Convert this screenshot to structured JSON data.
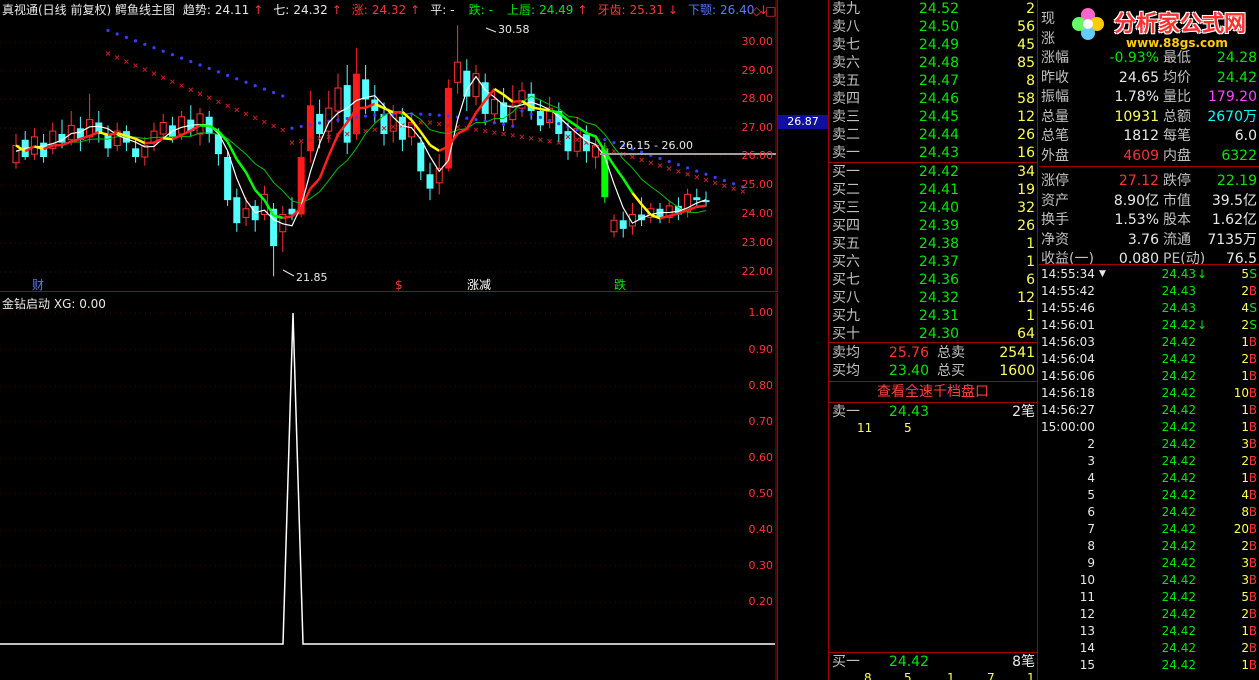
{
  "main_chart": {
    "title": "真视通(日线 前复权) 鳄鱼线主图",
    "indicators": [
      {
        "label": "趋势:",
        "value": "24.11",
        "arrow": "↑",
        "color": "#e8e8e8"
      },
      {
        "label": "七:",
        "value": "24.32",
        "arrow": "↑",
        "color": "#e8e8e8"
      },
      {
        "label": "涨:",
        "value": "24.32",
        "arrow": "↑",
        "color": "#ff3232"
      },
      {
        "label": "平:",
        "value": "-",
        "arrow": "",
        "color": "#e8e8e8"
      },
      {
        "label": "跌:",
        "value": "-",
        "arrow": "",
        "color": "#00e600"
      },
      {
        "label": "上唇:",
        "value": "24.49",
        "arrow": "↑",
        "color": "#00e600"
      },
      {
        "label": "牙齿:",
        "value": "25.31",
        "arrow": "↓",
        "color": "#ff3232"
      },
      {
        "label": "下颚:",
        "value": "26.40",
        "arrow": "↓",
        "color": "#5a78ff"
      }
    ],
    "y_axis": [
      "30.00",
      "29.00",
      "28.00",
      "27.00",
      "26.00",
      "25.00",
      "24.00",
      "23.00",
      "22.00"
    ],
    "current_price_tag": "26.87",
    "high_label": "30.58",
    "low_label": "21.85",
    "range_label": "26.15 - 26.00",
    "signals": [
      {
        "text": "财",
        "color": "#5a78ff"
      },
      {
        "text": "$",
        "color": "#ff3232"
      },
      {
        "text": "涨减",
        "color": "#ffffff"
      },
      {
        "text": "跌",
        "color": "#00e600"
      }
    ]
  },
  "sub_chart": {
    "title": "金钻启动",
    "value_label": "XG: 0.00",
    "y_axis": [
      "1.00",
      "0.90",
      "0.80",
      "0.70",
      "0.60",
      "0.50",
      "0.40",
      "0.30",
      "0.20"
    ]
  },
  "quote": {
    "asks": [
      {
        "label": "卖九",
        "price": "24.52",
        "vol": "2"
      },
      {
        "label": "卖八",
        "price": "24.50",
        "vol": "56"
      },
      {
        "label": "卖七",
        "price": "24.49",
        "vol": "45"
      },
      {
        "label": "卖六",
        "price": "24.48",
        "vol": "85"
      },
      {
        "label": "卖五",
        "price": "24.47",
        "vol": "8"
      },
      {
        "label": "卖四",
        "price": "24.46",
        "vol": "58"
      },
      {
        "label": "卖三",
        "price": "24.45",
        "vol": "12"
      },
      {
        "label": "卖二",
        "price": "24.44",
        "vol": "26"
      },
      {
        "label": "卖一",
        "price": "24.43",
        "vol": "16"
      }
    ],
    "bids": [
      {
        "label": "买一",
        "price": "24.42",
        "vol": "34"
      },
      {
        "label": "买二",
        "price": "24.41",
        "vol": "19"
      },
      {
        "label": "买三",
        "price": "24.40",
        "vol": "32"
      },
      {
        "label": "买四",
        "price": "24.39",
        "vol": "26"
      },
      {
        "label": "买五",
        "price": "24.38",
        "vol": "1"
      },
      {
        "label": "买六",
        "price": "24.37",
        "vol": "1"
      },
      {
        "label": "买七",
        "price": "24.36",
        "vol": "6"
      },
      {
        "label": "买八",
        "price": "24.32",
        "vol": "12"
      },
      {
        "label": "买九",
        "price": "24.31",
        "vol": "1"
      },
      {
        "label": "买十",
        "price": "24.30",
        "vol": "64"
      }
    ],
    "avg_sell": {
      "label": "卖均",
      "price": "25.76",
      "total_label": "总卖",
      "total": "2541"
    },
    "avg_buy": {
      "label": "买均",
      "price": "23.40",
      "total_label": "总买",
      "total": "1600"
    },
    "full_depth_button": "查看全速千档盘口",
    "queue_sell": {
      "label": "卖一",
      "price": "24.43",
      "count": "2笔",
      "orders": [
        "11",
        "5"
      ]
    },
    "queue_buy": {
      "label": "买一",
      "price": "24.42",
      "count": "8笔",
      "orders": [
        "8",
        "5",
        "1",
        "7",
        "1"
      ]
    }
  },
  "stats": [
    {
      "l1": "现",
      "v1": "",
      "l2": "",
      "v2": ""
    },
    {
      "l1": "涨",
      "v1": "",
      "l2": "",
      "v2": ""
    },
    {
      "l1": "涨幅",
      "v1": "-0.93%",
      "l2": "最低",
      "v2": "24.28"
    },
    {
      "l1": "昨收",
      "v1": "24.65",
      "l2": "均价",
      "v2": "24.42"
    },
    {
      "l1": "振幅",
      "v1": "1.78%",
      "l2": "量比",
      "v2": "179.20"
    },
    {
      "l1": "总量",
      "v1": "10931",
      "l2": "总额",
      "v2": "2670万"
    },
    {
      "l1": "总笔",
      "v1": "1812",
      "l2": "每笔",
      "v2": "6.0"
    },
    {
      "l1": "外盘",
      "v1": "4609",
      "l2": "内盘",
      "v2": "6322"
    },
    {
      "l1": "涨停",
      "v1": "27.12",
      "l2": "跌停",
      "v2": "22.19"
    },
    {
      "l1": "资产",
      "v1": "8.90亿",
      "l2": "市值",
      "v2": "39.5亿"
    },
    {
      "l1": "换手",
      "v1": "1.53%",
      "l2": "股本",
      "v2": "1.62亿"
    },
    {
      "l1": "净资",
      "v1": "3.76",
      "l2": "流通",
      "v2": "7135万"
    },
    {
      "l1": "收益(一)",
      "v1": "0.080",
      "l2": "PE(动)",
      "v2": "76.5"
    }
  ],
  "ticks": [
    {
      "time": "14:55:34",
      "mark": "▼",
      "price": "24.43",
      "arrow": "↓",
      "vol": "5",
      "dir": "S"
    },
    {
      "time": "14:55:42",
      "mark": "",
      "price": "24.43",
      "arrow": "",
      "vol": "2",
      "dir": "B"
    },
    {
      "time": "14:55:46",
      "mark": "",
      "price": "24.43",
      "arrow": "",
      "vol": "4",
      "dir": "S"
    },
    {
      "time": "14:56:01",
      "mark": "",
      "price": "24.42",
      "arrow": "↓",
      "vol": "2",
      "dir": "S"
    },
    {
      "time": "14:56:03",
      "mark": "",
      "price": "24.42",
      "arrow": "",
      "vol": "1",
      "dir": "B"
    },
    {
      "time": "14:56:04",
      "mark": "",
      "price": "24.42",
      "arrow": "",
      "vol": "2",
      "dir": "B"
    },
    {
      "time": "14:56:06",
      "mark": "",
      "price": "24.42",
      "arrow": "",
      "vol": "1",
      "dir": "B"
    },
    {
      "time": "14:56:18",
      "mark": "",
      "price": "24.42",
      "arrow": "",
      "vol": "10",
      "dir": "B"
    },
    {
      "time": "14:56:27",
      "mark": "",
      "price": "24.42",
      "arrow": "",
      "vol": "1",
      "dir": "B"
    },
    {
      "time": "15:00:00",
      "mark": "",
      "price": "24.42",
      "arrow": "",
      "vol": "1",
      "dir": "B"
    },
    {
      "time": "2",
      "mark": "",
      "price": "24.42",
      "arrow": "",
      "vol": "3",
      "dir": "B"
    },
    {
      "time": "3",
      "mark": "",
      "price": "24.42",
      "arrow": "",
      "vol": "2",
      "dir": "B"
    },
    {
      "time": "4",
      "mark": "",
      "price": "24.42",
      "arrow": "",
      "vol": "1",
      "dir": "B"
    },
    {
      "time": "5",
      "mark": "",
      "price": "24.42",
      "arrow": "",
      "vol": "4",
      "dir": "B"
    },
    {
      "time": "6",
      "mark": "",
      "price": "24.42",
      "arrow": "",
      "vol": "8",
      "dir": "B"
    },
    {
      "time": "7",
      "mark": "",
      "price": "24.42",
      "arrow": "",
      "vol": "20",
      "dir": "B"
    },
    {
      "time": "8",
      "mark": "",
      "price": "24.42",
      "arrow": "",
      "vol": "2",
      "dir": "B"
    },
    {
      "time": "9",
      "mark": "",
      "price": "24.42",
      "arrow": "",
      "vol": "3",
      "dir": "B"
    },
    {
      "time": "10",
      "mark": "",
      "price": "24.42",
      "arrow": "",
      "vol": "3",
      "dir": "B"
    },
    {
      "time": "11",
      "mark": "",
      "price": "24.42",
      "arrow": "",
      "vol": "5",
      "dir": "B"
    },
    {
      "time": "12",
      "mark": "",
      "price": "24.42",
      "arrow": "",
      "vol": "2",
      "dir": "B"
    },
    {
      "time": "13",
      "mark": "",
      "price": "24.42",
      "arrow": "",
      "vol": "1",
      "dir": "B"
    },
    {
      "time": "14",
      "mark": "",
      "price": "24.42",
      "arrow": "",
      "vol": "2",
      "dir": "B"
    },
    {
      "time": "15",
      "mark": "",
      "price": "24.42",
      "arrow": "",
      "vol": "1",
      "dir": "B"
    }
  ],
  "logo": {
    "text": "分析家公式网",
    "url": "www.88gs.com"
  },
  "window_icons": [
    "◇",
    "□"
  ]
}
